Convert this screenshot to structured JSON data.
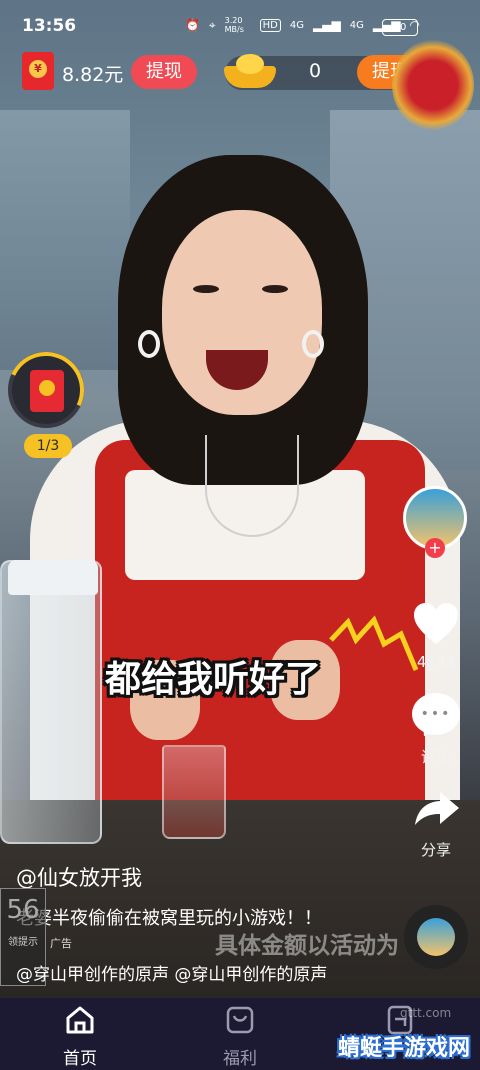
{
  "status_bar": {
    "time": "13:56",
    "network_speed": "3.20 MB/s",
    "hd_label": "HD",
    "signal_1": "4G",
    "signal_2": "4G",
    "battery": "70"
  },
  "rewards": {
    "cash_amount": "8.82元",
    "cash_withdraw_label": "提现",
    "gold_amount": "0",
    "gold_withdraw_label": "提现"
  },
  "task_widget": {
    "progress_text": "1/3"
  },
  "video": {
    "caption_text": "都给我听好了",
    "overlay_watermark": "具体金额以活动为",
    "author": "@仙女放开我",
    "description": "老婆半夜偷偷在被窝里玩的小游戏！！",
    "ad_tag": "广告",
    "music_text": "@穿山甲创作的原声   @穿山甲创作的原声",
    "ad_badge_big": "56",
    "ad_badge_small": "领提示"
  },
  "side_rail": {
    "likes_count": "4148",
    "comment_label": "评论",
    "share_label": "分享"
  },
  "bottom_nav": {
    "items": [
      {
        "label": "首页",
        "icon": "home-icon",
        "active": true
      },
      {
        "label": "福利",
        "icon": "gift-icon",
        "active": false
      },
      {
        "label": "",
        "icon": "wallet-icon",
        "active": false
      }
    ]
  },
  "site_watermark": {
    "name": "蜻蜓手游戏网",
    "url": "qttt.com"
  },
  "colors": {
    "withdraw_red": "#f04a54",
    "withdraw_orange": "#f77b1f",
    "nav_bg": "#1c1a33",
    "task_yellow": "#f6c223"
  }
}
